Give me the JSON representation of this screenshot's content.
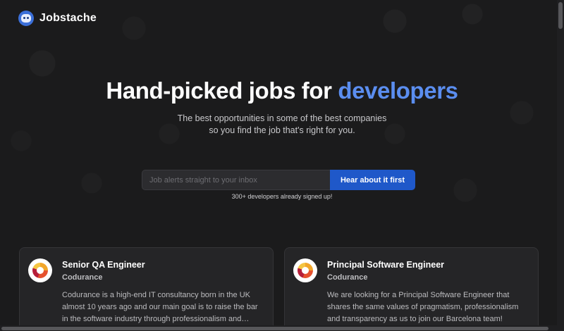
{
  "header": {
    "brand": "Jobstache",
    "logo_icon": "robot-logo-icon"
  },
  "hero": {
    "title_main": "Hand-picked jobs for ",
    "title_accent": "developers",
    "subtitle_line1": "The best opportunities in some of the best companies",
    "subtitle_line2": "so you find the job that's right for you."
  },
  "signup": {
    "placeholder": "Job alerts straight to your inbox",
    "button_label": "Hear about it first",
    "signed_up_text": "300+ developers already signed up!"
  },
  "jobs": [
    {
      "title": "Senior QA Engineer",
      "company": "Codurance",
      "description": "Codurance is a high-end IT consultancy born in the UK almost 10 years ago and our main goal is to raise the bar in the software industry through professionalism and…"
    },
    {
      "title": "Principal Software Engineer",
      "company": "Codurance",
      "description": "We are looking for a Principal Software Engineer that shares the same values of pragmatism, professionalism and transparency as us to join our Barcelona team!"
    }
  ],
  "colors": {
    "accent": "#5b8ef0",
    "button": "#1f58c9",
    "background": "#1b1b1c",
    "card": "#252527"
  }
}
